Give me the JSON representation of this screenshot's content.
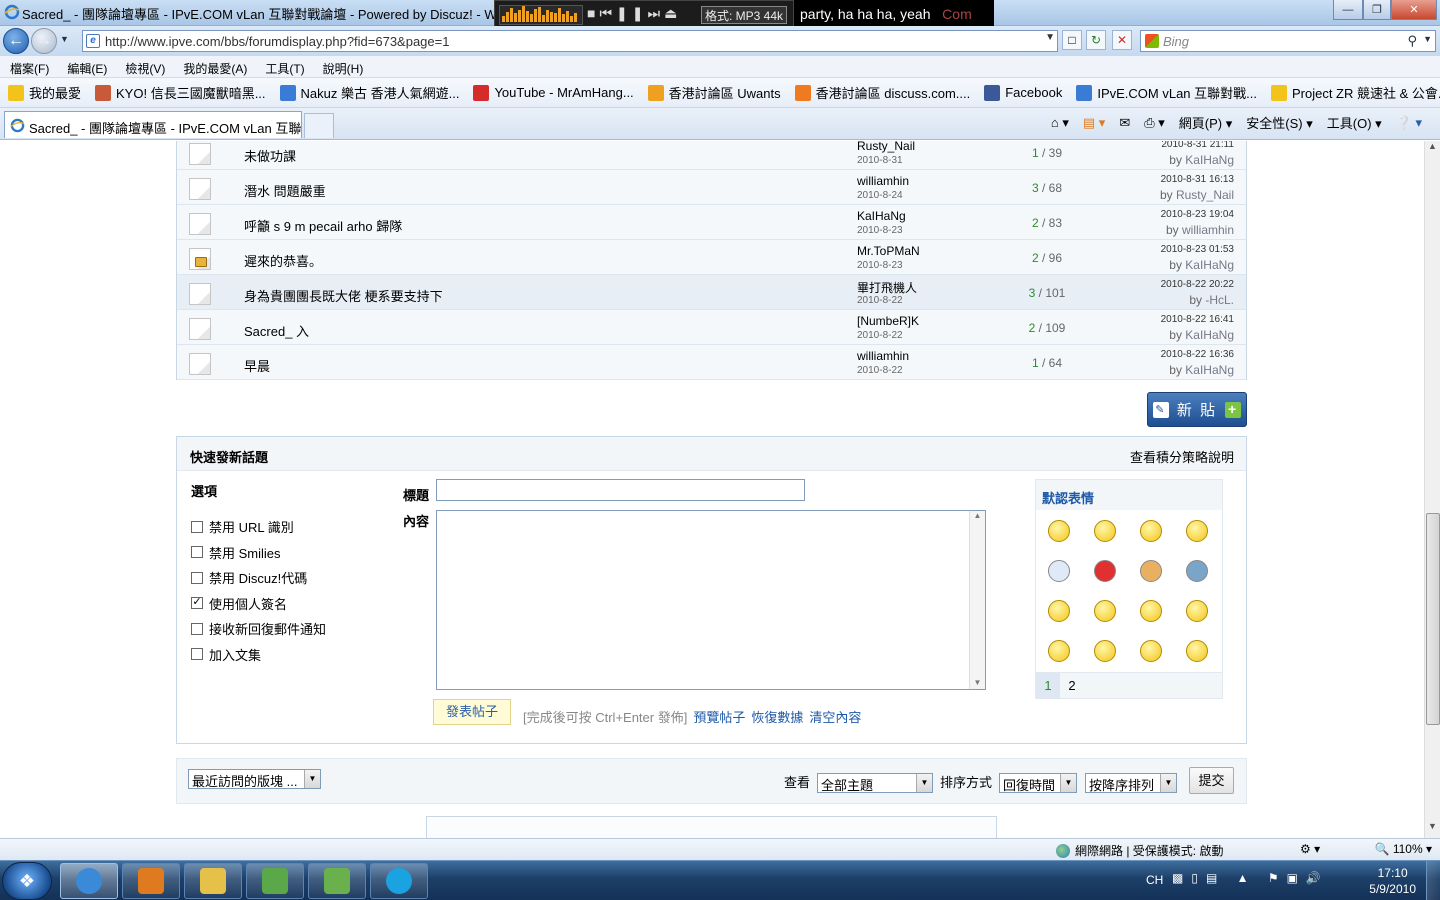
{
  "window": {
    "title": "Sacred_ - 團隊論壇專區 - IPvE.COM vLan 互聯對戰論壇 - Powered by Discuz! - Windo"
  },
  "player": {
    "format": "格式: MP3 44k",
    "lyric_main": "party, ha ha ha, yeah",
    "lyric_dim": "Com"
  },
  "browser": {
    "url": "http://www.ipve.com/bbs/forumdisplay.php?fid=673&page=1",
    "search_placeholder": "Bing",
    "menu": [
      "檔案(F)",
      "編輯(E)",
      "檢視(V)",
      "我的最愛(A)",
      "工具(T)",
      "說明(H)"
    ],
    "favorites": [
      {
        "label": "我的最愛",
        "color": "#f2c318"
      },
      {
        "label": "KYO! 信長三國魔獸暗黑...",
        "color": "#c85a3a"
      },
      {
        "label": "Nakuz 樂古 香港人氣網遊...",
        "color": "#3a7bd5"
      },
      {
        "label": "YouTube - MrAmHang...",
        "color": "#d62b2b"
      },
      {
        "label": "香港討論區 Uwants",
        "color": "#f0a020"
      },
      {
        "label": "香港討論區 discuss.com....",
        "color": "#f07a20"
      },
      {
        "label": "Facebook",
        "color": "#3b5998"
      },
      {
        "label": "IPvE.COM vLan 互聯對戰...",
        "color": "#3a7bd5"
      },
      {
        "label": "Project ZR 競速社 & 公會...",
        "color": "#f2c318"
      }
    ],
    "tab_title": "Sacred_ - 團隊論壇專區 - IPvE.COM vLan 互聯...",
    "cmd": {
      "page": "網頁(P)",
      "safety": "安全性(S)",
      "tools": "工具(O)"
    }
  },
  "threads": [
    {
      "subject": "未做功課",
      "author": "Rusty_Nail",
      "date": "2010-8-31",
      "replies": "1",
      "views": "39",
      "last_time": "2010-8-31 21:11",
      "last_by": "KaIHaNg",
      "locked": false,
      "hl": false
    },
    {
      "subject": "潛水 問題嚴重",
      "author": "williamhin",
      "date": "2010-8-24",
      "replies": "3",
      "views": "68",
      "last_time": "2010-8-31 16:13",
      "last_by": "Rusty_Nail",
      "locked": false,
      "hl": false
    },
    {
      "subject": "呼籲 s 9 m pecail arho 歸隊",
      "author": "KaIHaNg",
      "date": "2010-8-23",
      "replies": "2",
      "views": "83",
      "last_time": "2010-8-23 19:04",
      "last_by": "williamhin",
      "locked": false,
      "hl": false
    },
    {
      "subject": "遲來的恭喜。",
      "author": "Mr.ToPMaN",
      "date": "2010-8-23",
      "replies": "2",
      "views": "96",
      "last_time": "2010-8-23 01:53",
      "last_by": "KaIHaNg",
      "locked": true,
      "hl": false
    },
    {
      "subject": "身為貴團團長既大佬 梗系要支持下",
      "author": "畢打飛機人",
      "date": "2010-8-22",
      "replies": "3",
      "views": "101",
      "last_time": "2010-8-22 20:22",
      "last_by": "-HcL.",
      "locked": false,
      "hl": true
    },
    {
      "subject": "Sacred_ 入",
      "author": "[NumbeR]K",
      "date": "2010-8-22",
      "replies": "2",
      "views": "109",
      "last_time": "2010-8-22 16:41",
      "last_by": "KaIHaNg",
      "locked": false,
      "hl": false
    },
    {
      "subject": "早晨",
      "author": "williamhin",
      "date": "2010-8-22",
      "replies": "1",
      "views": "64",
      "last_time": "2010-8-22 16:36",
      "last_by": "KaIHaNg",
      "locked": false,
      "hl": false
    }
  ],
  "newpost_label": "新 貼",
  "quick": {
    "heading": "快速發新話題",
    "policy_link": "查看積分策略說明",
    "options_heading": "選項",
    "options": [
      {
        "label": "禁用 URL 識別",
        "checked": false
      },
      {
        "label": "禁用 Smilies",
        "checked": false
      },
      {
        "label": "禁用 Discuz!代碼",
        "checked": false
      },
      {
        "label": "使用個人簽名",
        "checked": true
      },
      {
        "label": "接收新回復郵件通知",
        "checked": false
      },
      {
        "label": "加入文集",
        "checked": false
      }
    ],
    "title_label": "標題",
    "content_label": "內容",
    "submit_label": "發表帖子",
    "hint": "[完成後可按 Ctrl+Enter 發佈]",
    "links": [
      "預覽帖子",
      "恢復數據",
      "清空內容"
    ],
    "smilies_heading": "默認表情",
    "smilies_pages": [
      "1",
      "2"
    ]
  },
  "filter": {
    "recent": "最近訪問的版塊 ...",
    "view_label": "查看",
    "view_value": "全部主題",
    "sort_label": "排序方式",
    "sort_value": "回復時間",
    "order_value": "按降序排列",
    "submit": "提交"
  },
  "status": {
    "zone": "網際網路 | 受保護模式: 啟動",
    "zoom": "110%"
  },
  "tray": {
    "lang": "CH",
    "time": "17:10",
    "date": "5/9/2010"
  },
  "taskbar_colors": [
    "#3a8ad8",
    "#e07a20",
    "#e6c14a",
    "#5aa84a",
    "#6ab04c",
    "#1aa3e0"
  ]
}
